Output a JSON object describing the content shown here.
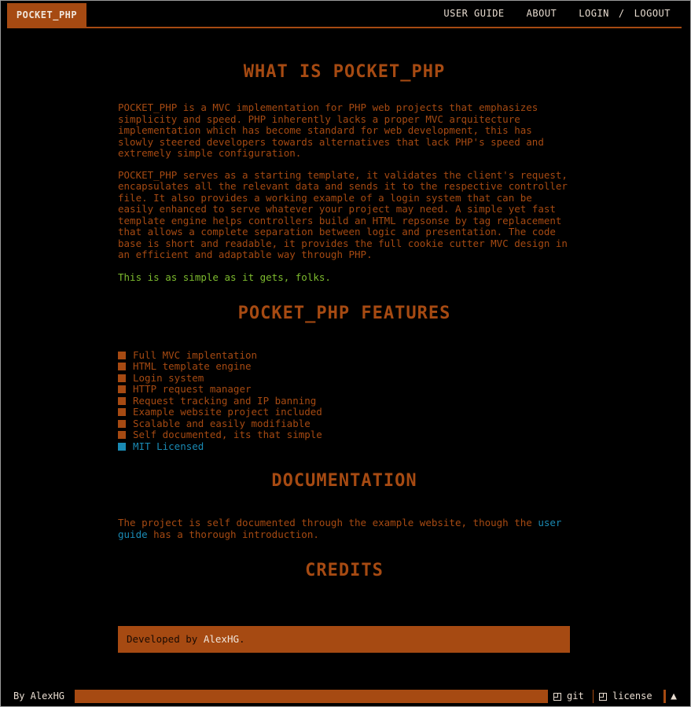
{
  "header": {
    "brand": "POCKET_PHP",
    "nav": {
      "user_guide": "USER GUIDE",
      "about": "ABOUT",
      "login": "LOGIN",
      "separator": "/",
      "logout": "LOGOUT"
    }
  },
  "sections": {
    "what_is": {
      "title": "WHAT IS POCKET_PHP",
      "paragraph1": "POCKET_PHP is a MVC implementation for PHP web projects that emphasizes simplicity and speed. PHP inherently lacks a proper MVC arquitecture implementation which has become standard for web development, this has slowly steered developers towards alternatives that lack PHP's speed and extremely simple configuration.",
      "paragraph2": "POCKET_PHP serves as a starting template, it validates the client's request, encapsulates all the relevant data and sends it to the respective controller file. It also provides a working example of a login system that can be easily enhanced to serve whatever your project may need. A simple yet fast template engine helps controllers build an HTML repsonse by tag replacement that allows a complete separation between logic and presentation. The code base is short and readable, it provides the full cookie cutter MVC design in an efficient and adaptable way through PHP.",
      "tagline": "This is as simple as it gets, folks."
    },
    "features": {
      "title": "POCKET_PHP FEATURES",
      "items": [
        "Full MVC implentation",
        "HTML template engine",
        "Login system",
        "HTTP request manager",
        "Request tracking and IP banning",
        "Example website project included",
        "Scalable and easily modifiable",
        "Self documented, its that simple",
        "MIT Licensed"
      ]
    },
    "documentation": {
      "title": "DOCUMENTATION",
      "text_before": "The project is self documented through the example website, though the ",
      "link": "user guide",
      "text_after": " has a thorough introduction."
    },
    "credits": {
      "title": "CREDITS",
      "prefix": "Developed by ",
      "author": "AlexHG",
      "suffix": "."
    }
  },
  "footer": {
    "byline": "By AlexHG",
    "git": "git",
    "license": "license",
    "up_arrow": "▲"
  },
  "colors": {
    "background": "#000000",
    "accent": "#a64a12",
    "tagline_green": "#7dbb2e",
    "link_blue": "#1a8ab4",
    "light_text": "#e8dcd0"
  }
}
